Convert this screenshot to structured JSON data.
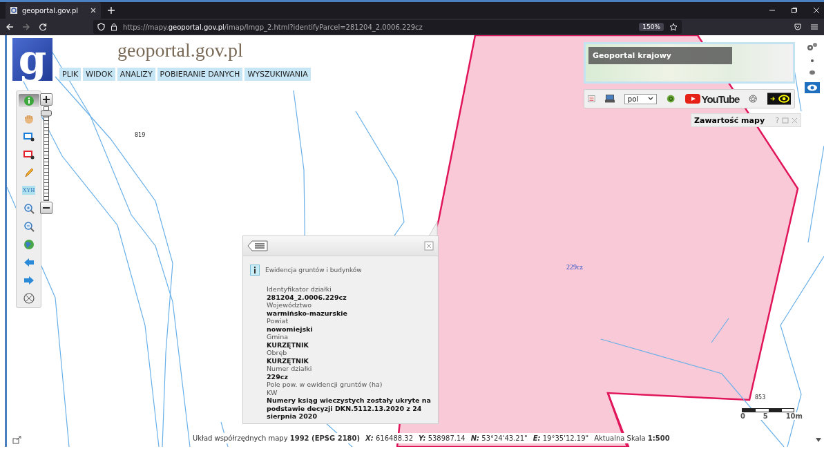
{
  "browser": {
    "tab_title": "geoportal.gov.pl",
    "url": "https://mapy.**geoportal.gov.pl**/imap/Imgp_2.html?identifyParcel=281204_2.0006.229cz",
    "zoom": "150%"
  },
  "header": {
    "logo_mark": "g",
    "title": "geoportal.gov.pl",
    "menu": [
      "PLIK",
      "WIDOK",
      "ANALIZY",
      "POBIERANIE DANYCH",
      "WYSZUKIWANIA"
    ]
  },
  "tools": [
    {
      "kind": "info",
      "selected": true
    },
    {
      "kind": "hand",
      "selected": false
    },
    {
      "kind": "select-blue",
      "selected": false
    },
    {
      "kind": "select-red",
      "selected": false
    },
    {
      "kind": "pencil",
      "selected": false
    },
    {
      "kind": "xyh",
      "label": "XYH",
      "selected": false
    },
    {
      "kind": "zoom-in",
      "selected": false
    },
    {
      "kind": "zoom-out",
      "selected": false
    },
    {
      "kind": "globe",
      "selected": false
    },
    {
      "kind": "back",
      "selected": false
    },
    {
      "kind": "forward",
      "selected": false
    },
    {
      "kind": "crosshair",
      "selected": false
    }
  ],
  "zoom_slider": {
    "level": 0.93
  },
  "map_labels": [
    {
      "text": "819",
      "kind": "point"
    },
    {
      "text": "229cz",
      "kind": "parcel"
    },
    {
      "text": "853",
      "kind": "point"
    }
  ],
  "overview": {
    "title": "Geoportal krajowy"
  },
  "map_toolbar": {
    "language": "pol",
    "video_label": "YouTube"
  },
  "contents_panel": {
    "title": "Zawartość mapy",
    "help": "?"
  },
  "popup": {
    "title": "Ewidencja gruntów i budynków",
    "fields": [
      {
        "label": "Identyfikator działki",
        "value": "281204_2.0006.229cz"
      },
      {
        "label": "Województwo",
        "value": "warmińsko-mazurskie"
      },
      {
        "label": "Powiat",
        "value": "nowomiejski"
      },
      {
        "label": "Gmina",
        "value": "KURZĘTNIK"
      },
      {
        "label": "Obręb",
        "value": "KURZĘTNIK"
      },
      {
        "label": "Numer działki",
        "value": "229cz"
      },
      {
        "label": "Pole pow. w ewidencji gruntów (ha)"
      },
      {
        "label": "KW",
        "value": "Numery ksiąg wieczystych zostały ukryte na podstawie decyzji DKN.5112.13.2020 z 24 sierpnia 2020"
      }
    ]
  },
  "scale_bar": {
    "ticks": [
      "0",
      "5",
      "10m"
    ]
  },
  "status_bar": {
    "system": "Układ współrzędnych mapy **1992 (EPSG 2180)**",
    "coords": [
      {
        "label": "X:",
        "value": "616488.32"
      },
      {
        "label": "Y:",
        "value": "538987.14"
      },
      {
        "label": "N:",
        "value": "53°24'43.21\""
      },
      {
        "label": "E:",
        "value": "19°35'12.19\""
      }
    ],
    "scale": "Aktualna Skala **1:500**"
  }
}
